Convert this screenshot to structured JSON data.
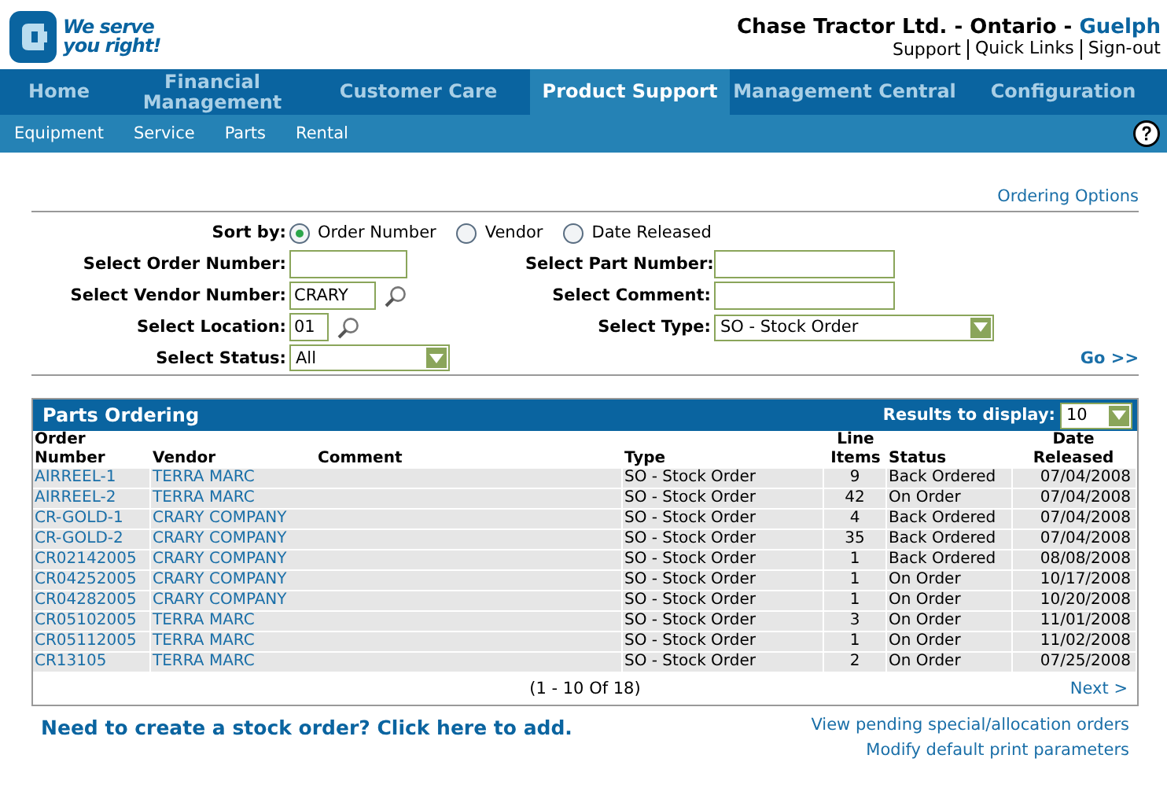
{
  "header": {
    "logo_text": [
      "We serve",
      "you right!"
    ],
    "company": "Chase Tractor Ltd. - Ontario - ",
    "branch": "Guelph",
    "links": [
      "Support",
      "Quick Links",
      "Sign-out"
    ]
  },
  "tabs": [
    {
      "label": "Home",
      "selected": false
    },
    {
      "label": "Financial Management",
      "selected": false
    },
    {
      "label": "Customer Care",
      "selected": false
    },
    {
      "label": "Product Support",
      "selected": true
    },
    {
      "label": "Management Central",
      "selected": false
    },
    {
      "label": "Configuration",
      "selected": false
    }
  ],
  "subnav": [
    "Equipment",
    "Service",
    "Parts",
    "Rental"
  ],
  "ordering_options": "Ordering Options",
  "sort": {
    "label": "Sort by:",
    "options": [
      {
        "label": "Order Number",
        "selected": true
      },
      {
        "label": "Vendor",
        "selected": false
      },
      {
        "label": "Date Released",
        "selected": false
      }
    ]
  },
  "fields": {
    "order_number": {
      "label": "Select Order Number:"
    },
    "part_number": {
      "label": "Select Part Number:"
    },
    "vendor_number": {
      "label": "Select Vendor Number:",
      "value": "CRARY"
    },
    "comment": {
      "label": "Select Comment:"
    },
    "location": {
      "label": "Select Location:",
      "value": "01"
    },
    "type": {
      "label": "Select Type:",
      "value": "SO - Stock Order"
    },
    "status": {
      "label": "Select Status:",
      "value": "All"
    }
  },
  "go": "Go >>",
  "table": {
    "title": "Parts Ordering",
    "results_label": "Results to display:",
    "results_value": "10",
    "columns": [
      "Order\nNumber",
      "Vendor",
      "Comment",
      "Type",
      "Line\nItems",
      "Status",
      "Date\nReleased"
    ],
    "rows": [
      [
        "AIRREEL-1",
        "TERRA MARC",
        "",
        "SO - Stock Order",
        "9",
        "Back Ordered",
        "07/04/2008"
      ],
      [
        "AIRREEL-2",
        "TERRA MARC",
        "",
        "SO - Stock Order",
        "42",
        "On Order",
        "07/04/2008"
      ],
      [
        "CR-GOLD-1",
        "CRARY COMPANY",
        "",
        "SO - Stock Order",
        "4",
        "Back Ordered",
        "07/04/2008"
      ],
      [
        "CR-GOLD-2",
        "CRARY COMPANY",
        "",
        "SO - Stock Order",
        "35",
        "Back Ordered",
        "07/04/2008"
      ],
      [
        "CR02142005",
        "CRARY COMPANY",
        "",
        "SO - Stock Order",
        "1",
        "Back Ordered",
        "08/08/2008"
      ],
      [
        "CR04252005",
        "CRARY COMPANY",
        "",
        "SO - Stock Order",
        "1",
        "On Order",
        "10/17/2008"
      ],
      [
        "CR04282005",
        "CRARY COMPANY",
        "",
        "SO - Stock Order",
        "1",
        "On Order",
        "10/20/2008"
      ],
      [
        "CR05102005",
        "TERRA MARC",
        "",
        "SO - Stock Order",
        "3",
        "On Order",
        "11/01/2008"
      ],
      [
        "CR05112005",
        "TERRA MARC",
        "",
        "SO - Stock Order",
        "1",
        "On Order",
        "11/02/2008"
      ],
      [
        "CR13105",
        "TERRA MARC",
        "",
        "SO - Stock Order",
        "2",
        "On Order",
        "07/25/2008"
      ]
    ],
    "pagination": "(1  -  10  Of  18)",
    "next": "Next >"
  },
  "create_link": "Need to create a stock order? Click here to add.",
  "side_links": [
    "View pending special/allocation orders",
    "Modify default print parameters"
  ]
}
